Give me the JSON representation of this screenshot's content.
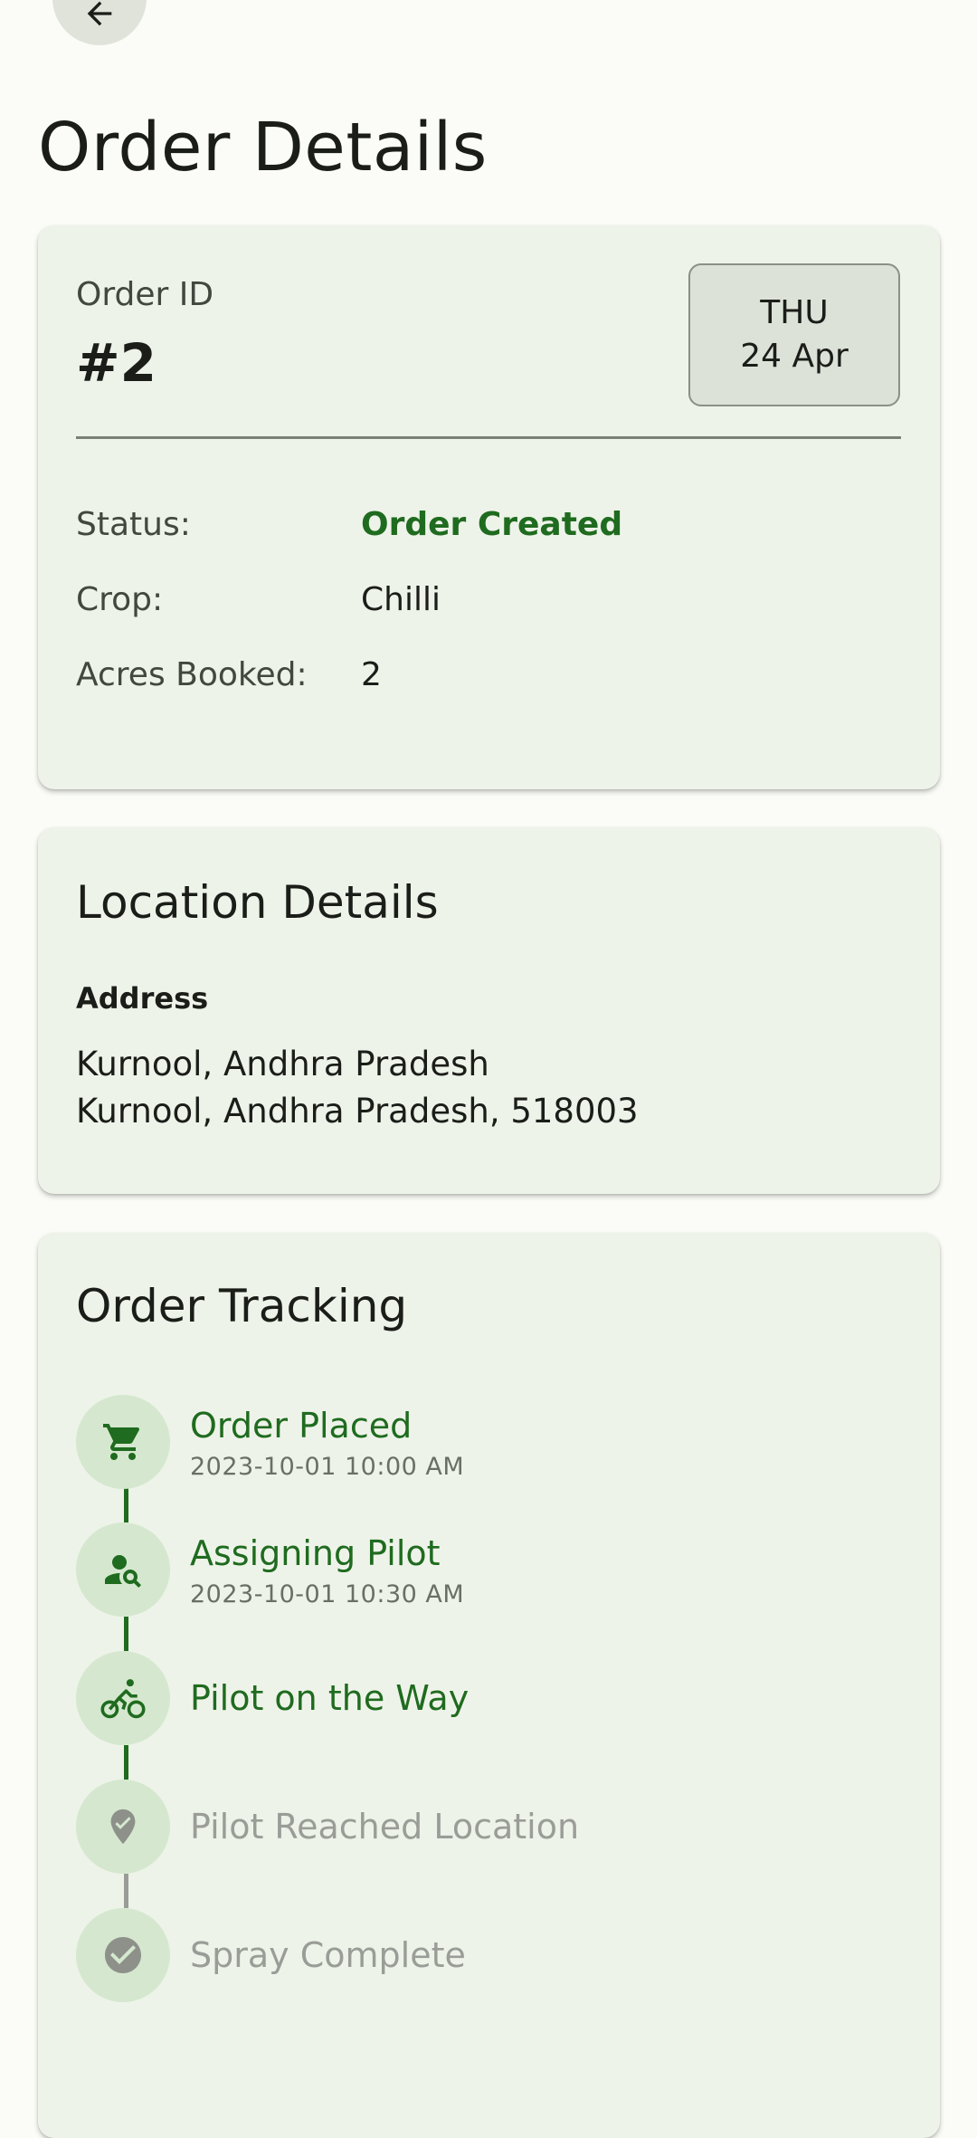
{
  "header": {
    "back_icon": "arrow-back-icon",
    "title": "Order Details"
  },
  "order": {
    "id_label": "Order ID",
    "id_value": "#2",
    "date_day": "THU",
    "date_date": "24 Apr",
    "rows": [
      {
        "label": "Status:",
        "value": "Order Created"
      },
      {
        "label": "Crop:",
        "value": "Chilli"
      },
      {
        "label": "Acres Booked:",
        "value": "2"
      }
    ]
  },
  "location": {
    "title": "Location Details",
    "address_label": "Address",
    "address_line1": "Kurnool, Andhra Pradesh",
    "address_line2": "Kurnool, Andhra Pradesh, 518003"
  },
  "tracking": {
    "title": "Order Tracking",
    "steps": [
      {
        "title": "Order Placed",
        "time": "2023-10-01 10:00 AM",
        "state": "done",
        "icon": "shopping-cart-icon"
      },
      {
        "title": "Assigning Pilot",
        "time": "2023-10-01 10:30 AM",
        "state": "done",
        "icon": "person-search-icon"
      },
      {
        "title": "Pilot on the Way",
        "time": "",
        "state": "done",
        "icon": "bike-rider-icon"
      },
      {
        "title": "Pilot Reached Location",
        "time": "",
        "state": "pending",
        "icon": "location-check-icon"
      },
      {
        "title": "Spray Complete",
        "time": "",
        "state": "pending",
        "icon": "check-circle-icon"
      }
    ]
  },
  "colors": {
    "background": "#fbfcf7",
    "card": "#eef3e9",
    "accent_green": "#1f6b1f",
    "pending_grey": "#9a9d97",
    "step_circle": "#d5e8cf"
  }
}
